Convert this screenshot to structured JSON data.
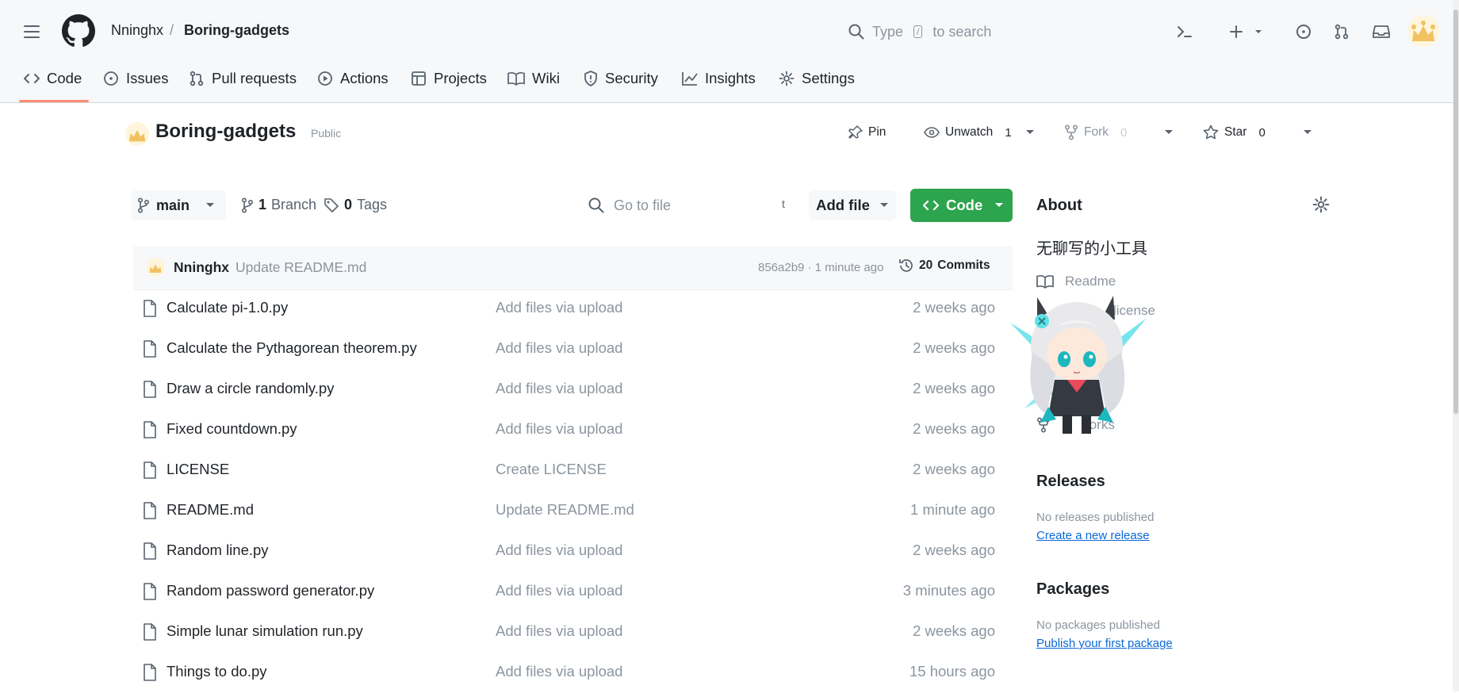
{
  "header": {
    "owner": "Nninghx",
    "separator": "/",
    "repo": "Boring-gadgets",
    "search": {
      "pre": "Type",
      "key": "/",
      "post": "to search"
    }
  },
  "tabs": [
    {
      "label": "Code",
      "icon": "code-icon"
    },
    {
      "label": "Issues",
      "icon": "issue-icon"
    },
    {
      "label": "Pull requests",
      "icon": "pull-request-icon"
    },
    {
      "label": "Actions",
      "icon": "play-icon"
    },
    {
      "label": "Projects",
      "icon": "table-icon"
    },
    {
      "label": "Wiki",
      "icon": "book-icon"
    },
    {
      "label": "Security",
      "icon": "shield-icon"
    },
    {
      "label": "Insights",
      "icon": "graph-icon"
    },
    {
      "label": "Settings",
      "icon": "gear-icon"
    }
  ],
  "repo_header": {
    "name": "Boring-gadgets",
    "visibility": "Public",
    "pin": "Pin",
    "unwatch": "Unwatch",
    "unwatch_count": "1",
    "fork": "Fork",
    "fork_count": "0",
    "star": "Star",
    "star_count": "0"
  },
  "toolbar": {
    "branch": "main",
    "branches_count": "1",
    "branches_label": "Branch",
    "tags_count": "0",
    "tags_label": "Tags",
    "goto_placeholder": "Go to file",
    "goto_key": "t",
    "add_file": "Add file",
    "code": "Code"
  },
  "commit": {
    "author": "Nninghx",
    "message": "Update README.md",
    "hash_time": "856a2b9 · 1 minute ago",
    "commits_count": "20",
    "commits_label": "Commits"
  },
  "files": [
    {
      "name": "Calculate pi-1.0.py",
      "message": "Add files via upload",
      "date": "2 weeks ago"
    },
    {
      "name": "Calculate the Pythagorean theorem.py",
      "message": "Add files via upload",
      "date": "2 weeks ago"
    },
    {
      "name": "Draw a circle randomly.py",
      "message": "Add files via upload",
      "date": "2 weeks ago"
    },
    {
      "name": "Fixed countdown.py",
      "message": "Add files via upload",
      "date": "2 weeks ago"
    },
    {
      "name": "LICENSE",
      "message": "Create LICENSE",
      "date": "2 weeks ago"
    },
    {
      "name": "README.md",
      "message": "Update README.md",
      "date": "1 minute ago"
    },
    {
      "name": "Random line.py",
      "message": "Add files via upload",
      "date": "2 weeks ago"
    },
    {
      "name": "Random password generator.py",
      "message": "Add files via upload",
      "date": "3 minutes ago"
    },
    {
      "name": "Simple lunar simulation run.py",
      "message": "Add files via upload",
      "date": "2 weeks ago"
    },
    {
      "name": "Things to do.py",
      "message": "Add files via upload",
      "date": "15 hours ago"
    }
  ],
  "about": {
    "heading": "About",
    "description": "无聊写的小工具",
    "readme": "Readme",
    "license": "license",
    "forks": "forks"
  },
  "releases": {
    "heading": "Releases",
    "none": "No releases published",
    "link": "Create a new release"
  },
  "packages": {
    "heading": "Packages",
    "none": "No packages published",
    "link": "Publish your first package"
  },
  "colors": {
    "primary_button": "#2da44e",
    "link": "#0969da",
    "tab_underline": "#fd8c73",
    "muted_text": "#8c959f"
  }
}
